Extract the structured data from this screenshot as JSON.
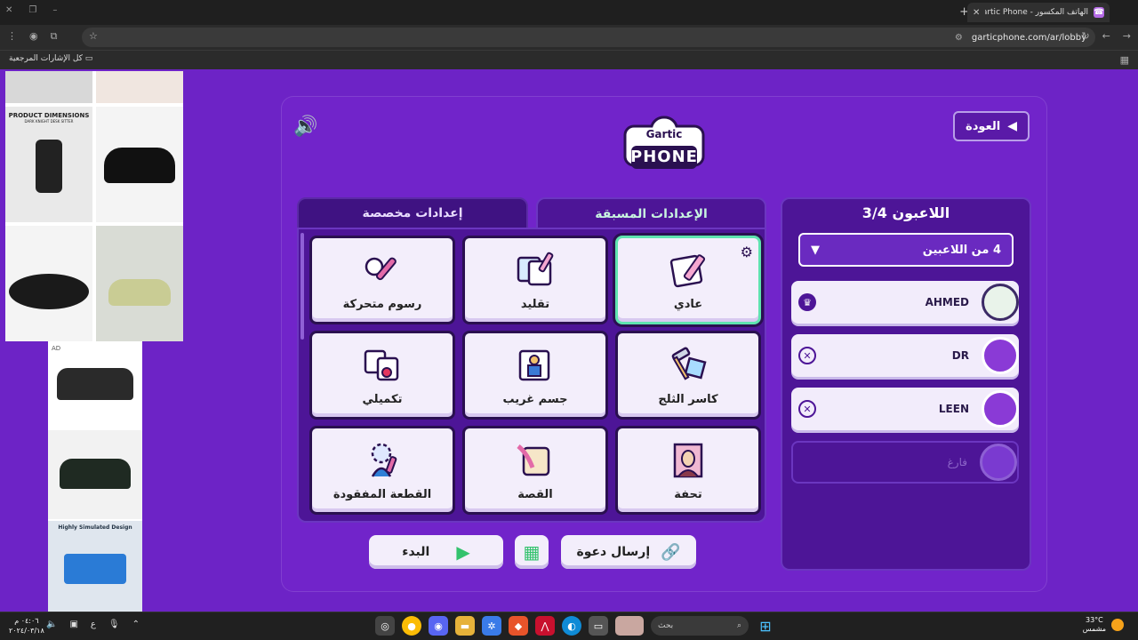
{
  "browser": {
    "tab_title": "الهاتف المكسور - Gartic Phone",
    "url": "garticphone.com/ar/lobby",
    "bookmarks_label": "كل الإشارات المرجعية"
  },
  "ads": {
    "banner1": "PRODUCT DIMENSIONS",
    "banner1_sub": "DARK KNIGHT DESK SITTER",
    "ad_badge": "AD",
    "banner2": "Highly Simulated Design"
  },
  "game": {
    "back_label": "العودة",
    "logo_top": "Gartic",
    "logo_bottom": "PHONE",
    "players_title": "اللاعبون 3/4",
    "players_select": "4 من اللاعبين",
    "players": [
      {
        "name": "AHMED",
        "action": "crown"
      },
      {
        "name": "DR",
        "action": "kick"
      },
      {
        "name": "LEEN",
        "action": "kick"
      },
      {
        "name": "فارغ",
        "action": "none"
      }
    ],
    "tab_preset": "الإعدادات المسبقة",
    "tab_custom": "إعدادات مخصصة",
    "modes": [
      {
        "label": "عادي",
        "selected": true
      },
      {
        "label": "تقليد",
        "selected": false
      },
      {
        "label": "رسوم متحركة",
        "selected": false
      },
      {
        "label": "كاسر الثلج",
        "selected": false
      },
      {
        "label": "جسم غريب",
        "selected": false
      },
      {
        "label": "تكميلي",
        "selected": false
      },
      {
        "label": "تحفة",
        "selected": false
      },
      {
        "label": "القصة",
        "selected": false
      },
      {
        "label": "القطعة المفقودة",
        "selected": false
      }
    ],
    "start_label": "البدء",
    "invite_label": "إرسال دعوة"
  },
  "taskbar": {
    "search_placeholder": "بحث",
    "weather_temp": "33°C",
    "weather_desc": "مشمس",
    "time": "٠٤:٠٦ م",
    "date": "٢٠٢٤/٠٣/١٨",
    "lang": "ع"
  },
  "colors": {
    "bg": "#6d23c6",
    "panel": "#4d1597",
    "selected": "#5fe3b0",
    "card": "#f3eefb"
  }
}
